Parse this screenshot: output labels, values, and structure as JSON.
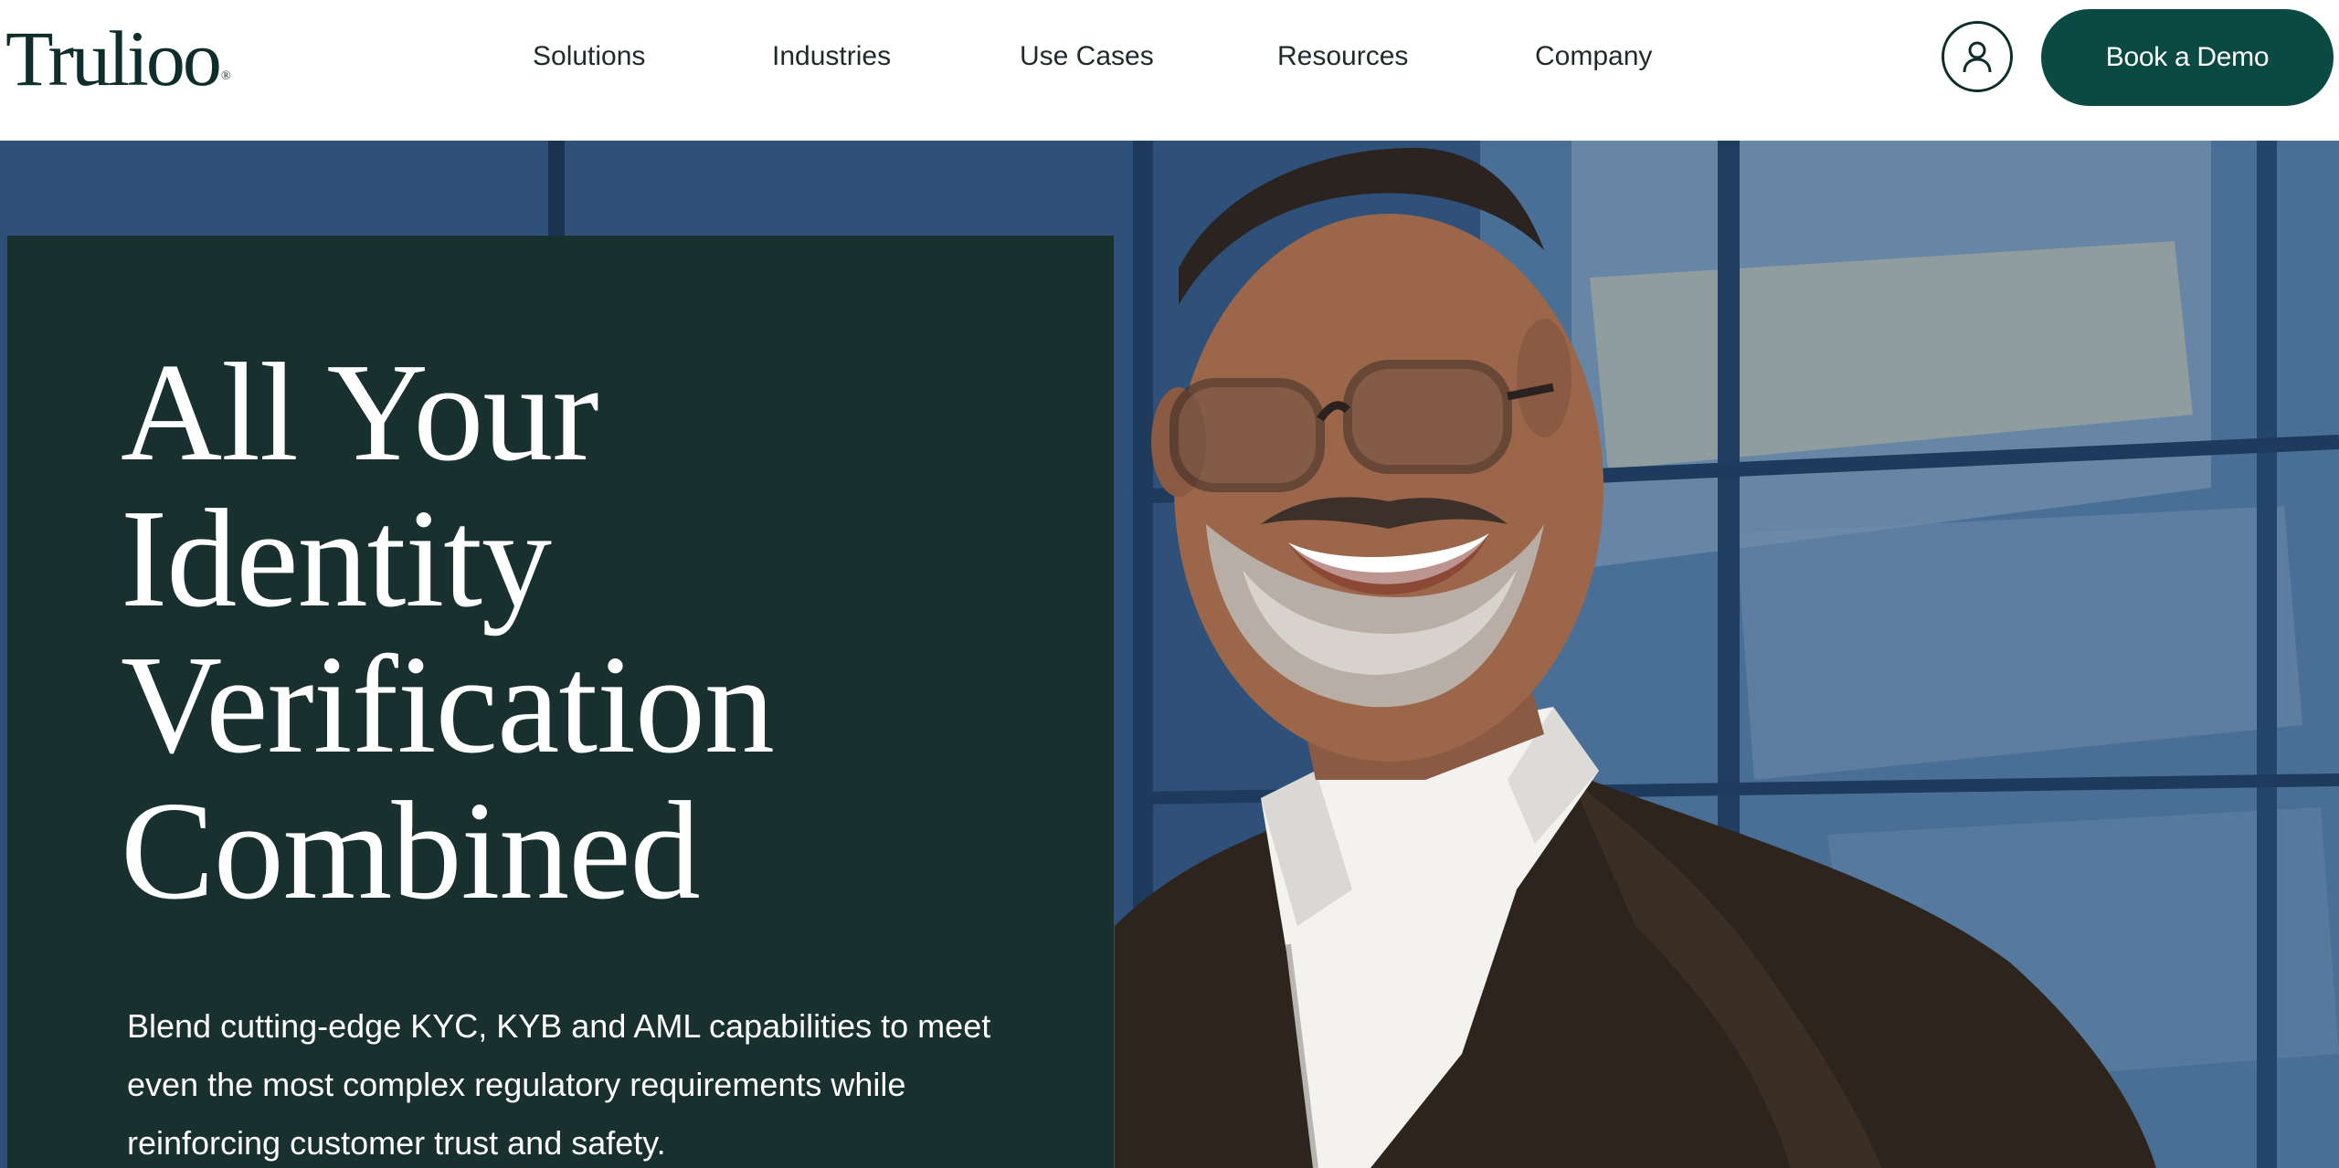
{
  "header": {
    "logo_text": "Trulioo",
    "logo_mark": "®",
    "nav": [
      {
        "label": "Solutions"
      },
      {
        "label": "Industries"
      },
      {
        "label": "Use Cases"
      },
      {
        "label": "Resources"
      },
      {
        "label": "Company"
      }
    ],
    "account_icon": "user-icon",
    "cta_label": "Book a Demo"
  },
  "hero": {
    "headline_lines": [
      "All Your",
      "Identity",
      "Verification",
      "Combined"
    ],
    "subtext": "Blend cutting-edge KYC, KYB and AML capabilities to meet even the most complex regulatory requirements while reinforcing customer trust and safety."
  },
  "colors": {
    "brand_dark": "#0f2e2b",
    "cta_bg": "#0b4a43",
    "panel_bg": "#18302e",
    "text_on_dark": "#ffffff"
  }
}
